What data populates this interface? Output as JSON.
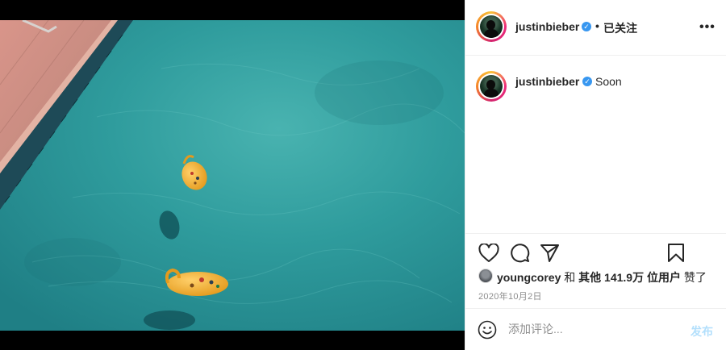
{
  "post": {
    "author": "justinbieber",
    "follow_state": "已关注",
    "separator": "•",
    "more_label": "•••",
    "caption": "Soon"
  },
  "engagement": {
    "liked_by": "youngcorey",
    "and_label": "和",
    "others_label": "其他",
    "count": "141.9万",
    "suffix": "位用户",
    "liked_label": "赞了",
    "date": "2020年10月2日"
  },
  "comment": {
    "placeholder": "添加评论...",
    "post_label": "发布"
  },
  "icons": {
    "verified": "verified-badge-icon",
    "like": "heart-icon",
    "comment": "comment-bubble-icon",
    "share": "paper-plane-icon",
    "save": "bookmark-icon",
    "emoji": "smiley-icon"
  },
  "colors": {
    "verified": "#3897f0",
    "post_button": "#b2dffc",
    "pool": "#2f8f92"
  }
}
